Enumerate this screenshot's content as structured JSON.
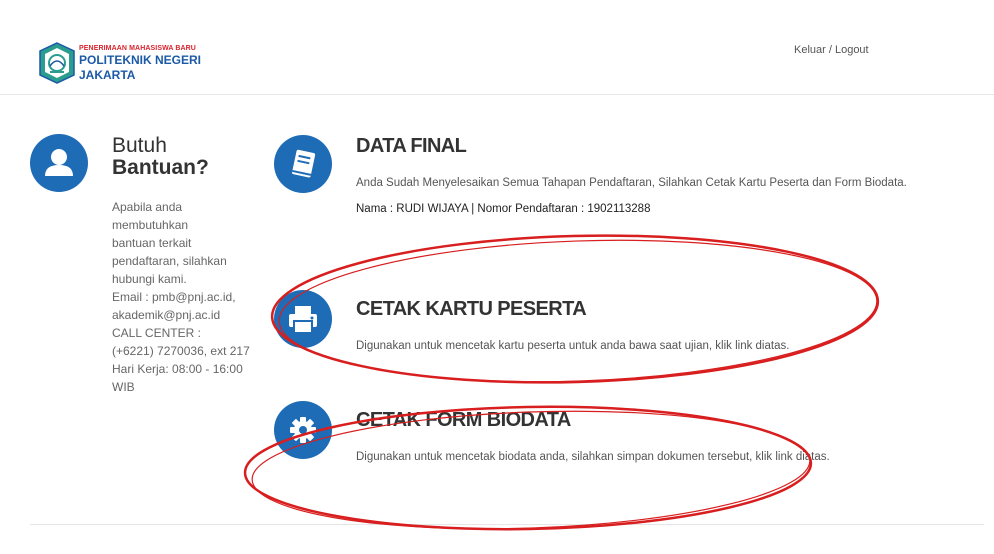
{
  "header": {
    "logo_small": "PENERIMAAN MAHASISWA BARU",
    "logo_main": "POLITEKNIK NEGERI",
    "logo_sub": "JAKARTA",
    "logout_label": "Keluar / Logout"
  },
  "help": {
    "title_line1": "Butuh",
    "title_line2": "Bantuan?",
    "lines": [
      "Apabila anda",
      "membutuhkan",
      "bantuan terkait",
      "pendaftaran, silahkan",
      "hubungi kami.",
      "Email : pmb@pnj.ac.id,",
      "akademik@pnj.ac.id",
      "CALL CENTER :",
      "(+6221) 7270036, ext 217",
      "Hari Kerja: 08:00 - 16:00",
      "WIB"
    ]
  },
  "data_final": {
    "title": "DATA FINAL",
    "description": "Anda Sudah Menyelesaikan Semua Tahapan Pendaftaran, Silahkan Cetak Kartu Peserta dan Form Biodata.",
    "info": "Nama : RUDI WIJAYA | Nomor Pendaftaran : 1902113288"
  },
  "cetak_kartu": {
    "title": "CETAK KARTU PESERTA",
    "description": "Digunakan untuk mencetak kartu peserta untuk anda bawa saat ujian, klik link diatas."
  },
  "cetak_form": {
    "title": "CETAK FORM BIODATA",
    "description": "Digunakan untuk mencetak biodata anda, silahkan simpan dokumen tersebut, klik link diatas."
  },
  "colors": {
    "accent_blue": "#1e6cb6",
    "annotation_red": "#d81e1e"
  },
  "icons": [
    "user-icon",
    "book-icon",
    "printer-icon",
    "gear-icon"
  ]
}
